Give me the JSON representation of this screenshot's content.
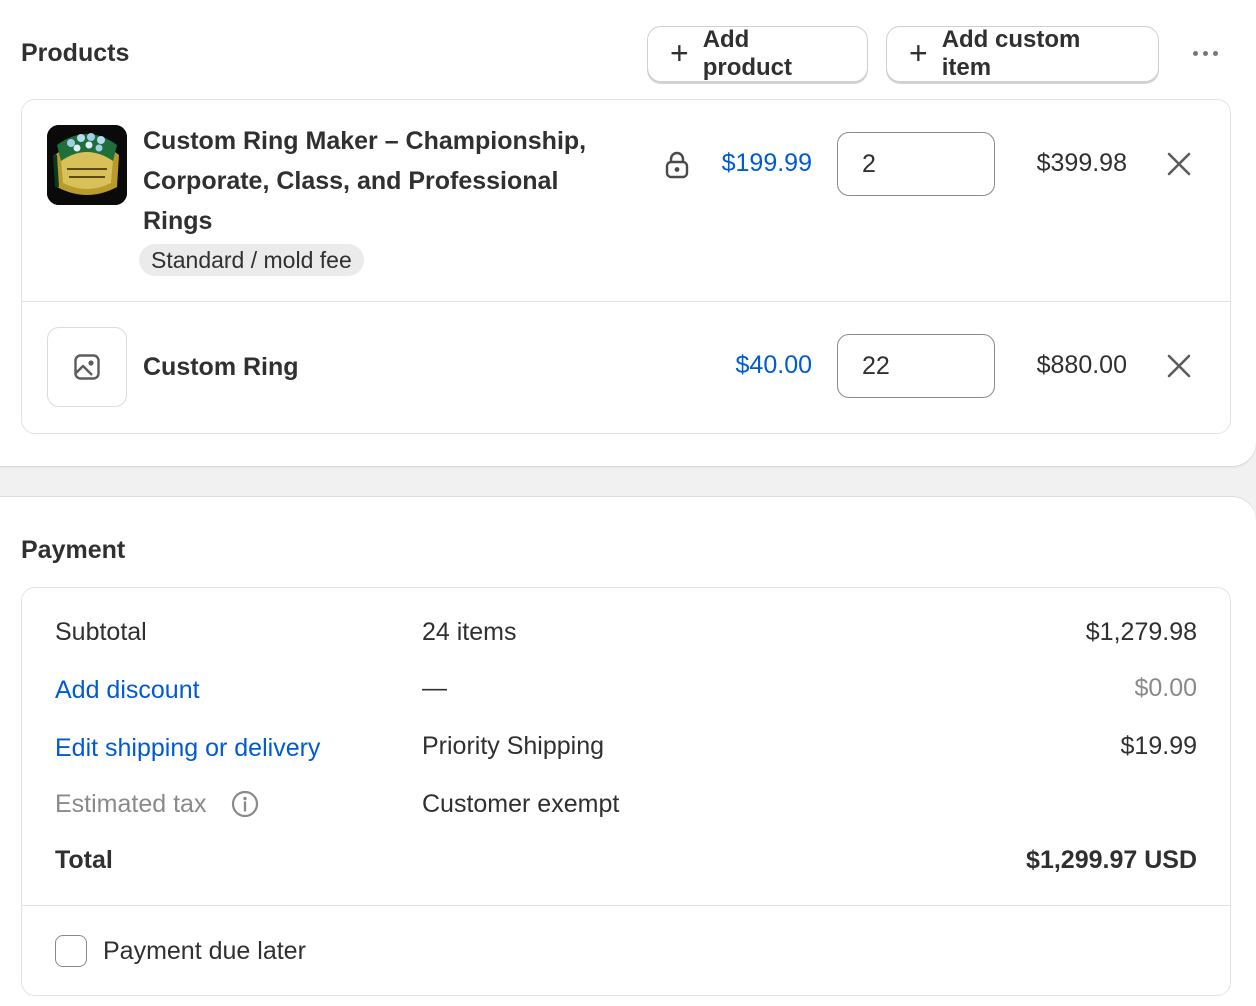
{
  "products": {
    "title": "Products",
    "add_product_label": "Add product",
    "add_custom_item_label": "Add custom item",
    "items": [
      {
        "title_lines": [
          "Custom Ring Maker – Championship,",
          "Corporate, Class, and Professional",
          "Rings"
        ],
        "variant": "Standard / mold fee",
        "price": "$199.99",
        "quantity": "2",
        "total": "$399.98"
      },
      {
        "title": "Custom Ring",
        "price": "$40.00",
        "quantity": "22",
        "total": "$880.00"
      }
    ]
  },
  "payment": {
    "title": "Payment",
    "subtotal": {
      "label": "Subtotal",
      "detail": "24 items",
      "amount": "$1,279.98"
    },
    "discount": {
      "label": "Add discount",
      "detail": "—",
      "amount": "$0.00"
    },
    "shipping": {
      "label": "Edit shipping or delivery",
      "detail": "Priority Shipping",
      "amount": "$19.99"
    },
    "tax": {
      "label": "Estimated tax",
      "detail": "Customer exempt"
    },
    "total": {
      "label": "Total",
      "amount": "$1,299.97 USD"
    },
    "due_later_label": "Payment due later",
    "due_later_checked": false
  },
  "colors": {
    "link": "#005bd3",
    "text": "#303030",
    "muted": "#8a8a8a",
    "background": "#f1f1f1"
  }
}
